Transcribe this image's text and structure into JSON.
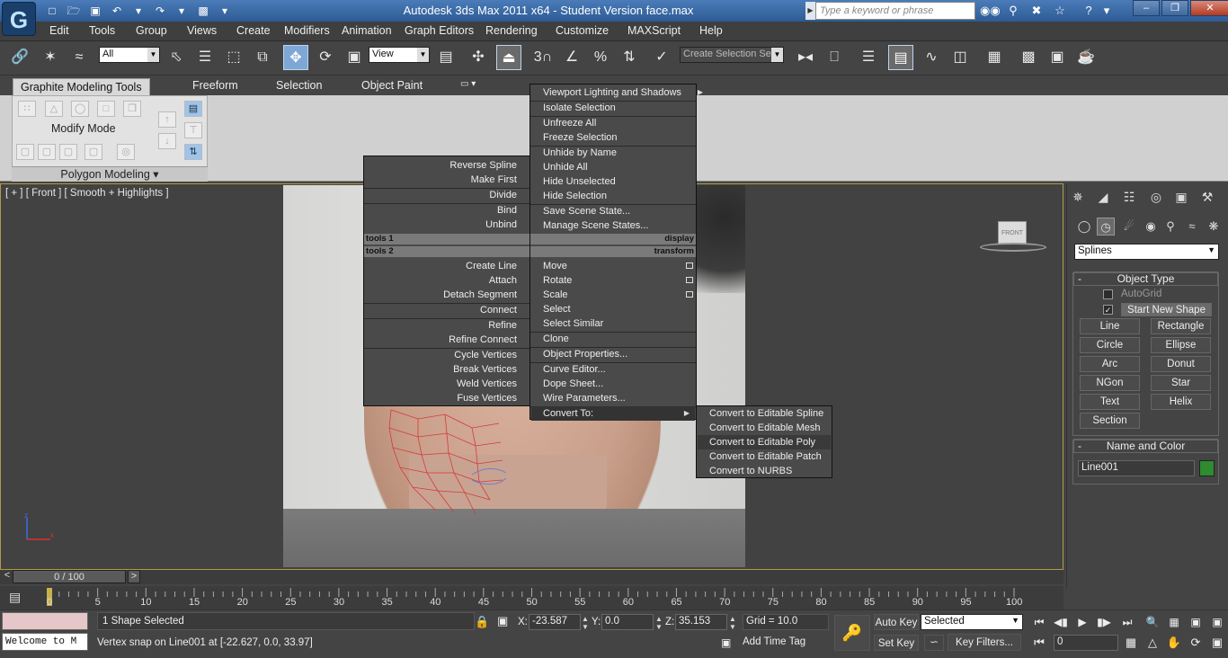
{
  "window": {
    "title": "Autodesk 3ds Max  2011 x64  - Student Version   face.max",
    "search_placeholder": "Type a keyword or phrase"
  },
  "menubar": [
    "Edit",
    "Tools",
    "Group",
    "Views",
    "Create",
    "Modifiers",
    "Animation",
    "Graph Editors",
    "Rendering",
    "Customize",
    "MAXScript",
    "Help"
  ],
  "toolbar": {
    "selection_filter": "All",
    "reference_coord": "View",
    "named_selection_placeholder": "Create Selection Se"
  },
  "ribbon": {
    "tabs": [
      "Graphite Modeling Tools",
      "Freeform",
      "Selection",
      "Object Paint"
    ],
    "panel_label": "Modify Mode",
    "panel_footer": "Polygon Modeling"
  },
  "viewport": {
    "label": "[ + ] [ Front ] [ Smooth + Highlights ]",
    "viewcube_label": "FRONT",
    "axis_z": "z",
    "axis_x": "x"
  },
  "quad_left": {
    "group1": [
      "Reverse Spline",
      "Make First"
    ],
    "group2": [
      "Divide"
    ],
    "group3": [
      "Bind",
      "Unbind"
    ],
    "header1": "tools 1",
    "header2": "tools 2",
    "group4": [
      "Create Line",
      "Attach",
      "Detach Segment"
    ],
    "group5": [
      "Connect"
    ],
    "group6": [
      "Refine",
      "Refine Connect"
    ],
    "group7": [
      "Cycle Vertices",
      "Break Vertices",
      "Weld Vertices",
      "Fuse Vertices"
    ]
  },
  "quad_right": {
    "viewport_lighting": "Viewport Lighting and Shadows",
    "group1": [
      "Isolate Selection"
    ],
    "group2": [
      "Unfreeze All",
      "Freeze Selection"
    ],
    "group3": [
      "Unhide by Name",
      "Unhide All",
      "Hide Unselected",
      "Hide Selection"
    ],
    "group4": [
      "Save Scene State...",
      "Manage Scene States..."
    ],
    "header1": "display",
    "header2": "transform",
    "group5": [
      "Move",
      "Rotate",
      "Scale",
      "Select",
      "Select Similar"
    ],
    "group6": [
      "Clone"
    ],
    "group7": [
      "Object Properties..."
    ],
    "group8": [
      "Curve Editor...",
      "Dope Sheet...",
      "Wire Parameters..."
    ],
    "convert_to": "Convert To:"
  },
  "submenu": [
    "Convert to Editable Spline",
    "Convert to Editable Mesh",
    "Convert to Editable Poly",
    "Convert to Editable Patch",
    "Convert to NURBS"
  ],
  "command_panel": {
    "category": "Splines",
    "object_type_title": "Object Type",
    "autogrid": "AutoGrid",
    "start_new_shape": "Start New Shape",
    "buttons": [
      "Line",
      "Rectangle",
      "Circle",
      "Ellipse",
      "Arc",
      "Donut",
      "NGon",
      "Star",
      "Text",
      "Helix",
      "Section"
    ],
    "name_color_title": "Name and Color",
    "object_name": "Line001",
    "object_color": "#2e8b2e"
  },
  "timeline": {
    "frame_display": "0 / 100",
    "ticks": [
      "0",
      "5",
      "10",
      "15",
      "20",
      "25",
      "30",
      "35",
      "40",
      "45",
      "50",
      "55",
      "60",
      "65",
      "70",
      "75",
      "80",
      "85",
      "90",
      "95",
      "100"
    ]
  },
  "status": {
    "maxscript_text": "Welcome to M",
    "selection_info": "1 Shape Selected",
    "prompt": "Vertex snap on Line001 at [-22.627, 0.0, 33.97]",
    "x_label": "X:",
    "x_value": "-23.587",
    "y_label": "Y:",
    "y_value": "0.0",
    "z_label": "Z:",
    "z_value": "35.153",
    "grid": "Grid = 10.0",
    "add_time_tag": "Add Time Tag",
    "auto_key": "Auto Key",
    "set_key": "Set Key",
    "selected": "Selected",
    "key_filters": "Key Filters...",
    "current_frame": "0"
  }
}
